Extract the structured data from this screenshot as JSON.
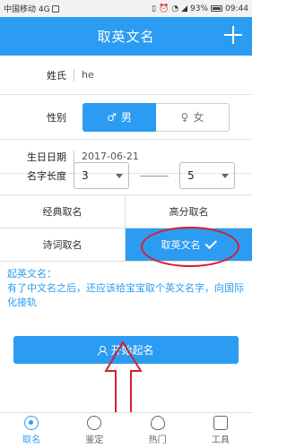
{
  "status_bar": {
    "carrier": "中国移动 4G",
    "battery": "93%",
    "time": "09:44"
  },
  "header": {
    "title": "取英文名"
  },
  "form": {
    "surname_label": "姓氏",
    "surname_value": "he",
    "gender_label": "性别",
    "gender_male": "男",
    "gender_female": "女",
    "birthday_label": "生日日期",
    "birthday_value": "2017-06-21",
    "length_label": "名字长度",
    "length_min": "3",
    "length_max": "5"
  },
  "modes": [
    {
      "label": "经典取名"
    },
    {
      "label": "高分取名"
    },
    {
      "label": "诗词取名"
    },
    {
      "label": "取英文名"
    }
  ],
  "description": {
    "title": "起英文名：",
    "body": "有了中文名之后，还应该给宝宝取个英文名字，向国际化接轨"
  },
  "start_button": {
    "label": "开始起名"
  },
  "bottom_nav": [
    {
      "label": "取名",
      "icon": "name-icon"
    },
    {
      "label": "鉴定",
      "icon": "appraise-icon"
    },
    {
      "label": "热门",
      "icon": "hot-icon"
    },
    {
      "label": "工具",
      "icon": "tools-icon"
    }
  ],
  "colors": {
    "primary": "#2b9cf2",
    "highlight": "#d61f2e"
  }
}
